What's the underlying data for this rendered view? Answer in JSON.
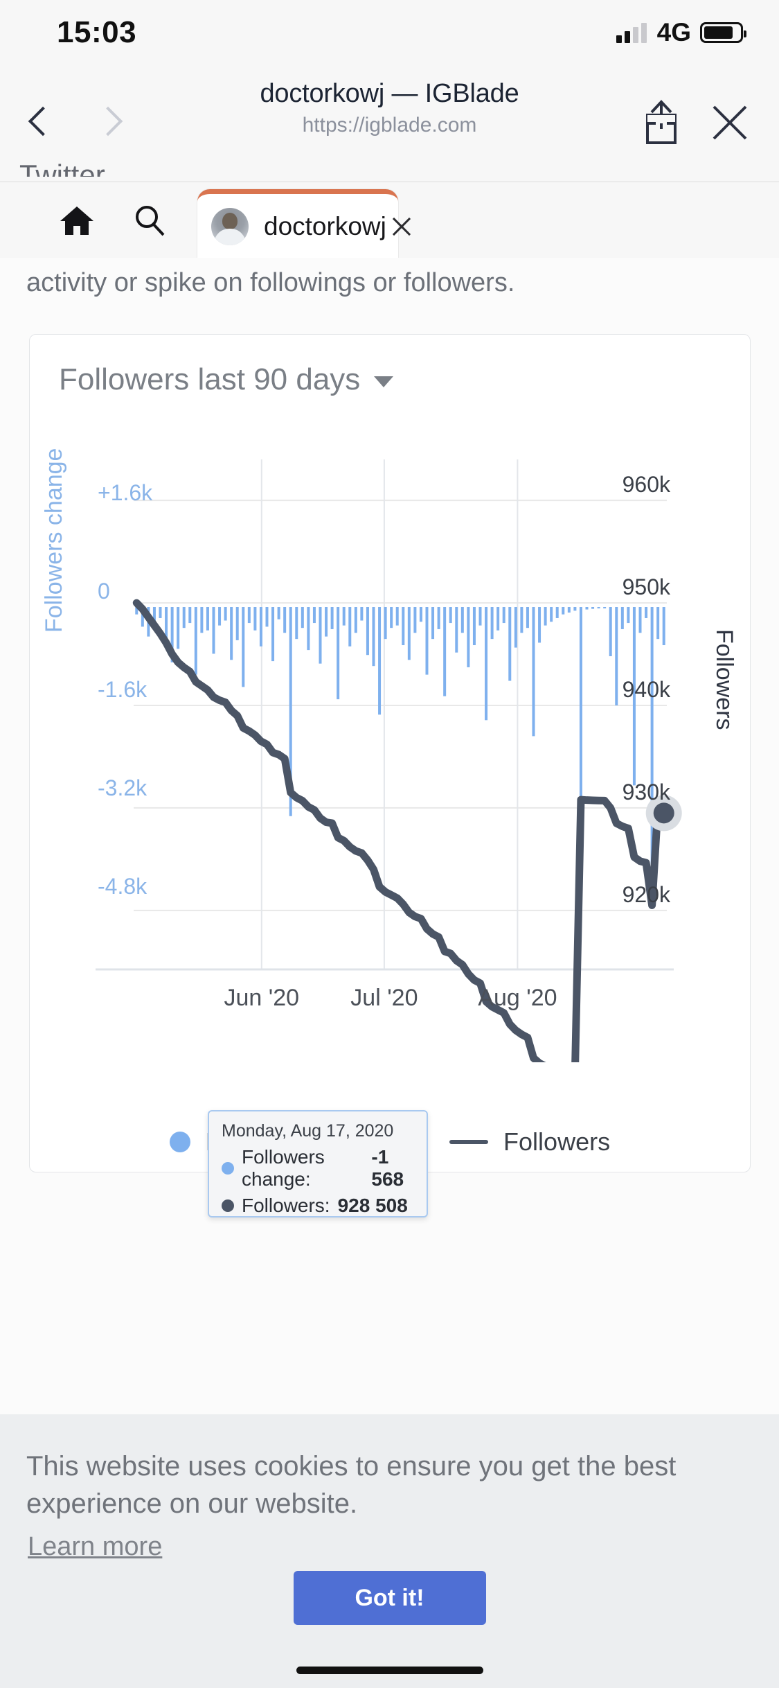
{
  "status_bar": {
    "time": "15:03",
    "network": "4G",
    "signal_icon": "cellular-signal-icon",
    "battery_icon": "battery-icon"
  },
  "browser": {
    "back_icon": "chevron-left-icon",
    "forward_icon": "chevron-right-icon",
    "title": "doctorkowj — IGBlade",
    "url": "https://igblade.com",
    "share_icon": "share-icon",
    "close_icon": "close-icon"
  },
  "tabstrip": {
    "ghost_text": "Twitter",
    "home_icon": "home-icon",
    "search_icon": "search-icon",
    "tab": {
      "avatar_icon": "avatar-icon",
      "label": "doctorkowj",
      "close_icon": "tab-close-icon",
      "accent_color": "#d9744f"
    }
  },
  "page": {
    "intro_text": "activity or spike on followings or followers.",
    "card": {
      "title": "Followers last 90 days",
      "dropdown_icon": "chevron-down-icon"
    }
  },
  "tooltip": {
    "date": "Monday, Aug 17, 2020",
    "rows": [
      {
        "marker": "blue",
        "label": "Followers change:",
        "value": "-1 568"
      },
      {
        "marker": "dark",
        "label": "Followers:",
        "value": "928 508"
      }
    ]
  },
  "cookie_banner": {
    "text": "This website uses cookies to ensure you get the best experience on our website.",
    "link": "Learn more",
    "button": "Got it!",
    "button_color": "#4f6fd4"
  },
  "chart_data": {
    "type": "line",
    "title": "Followers last 90 days",
    "xlabel": "",
    "ylabel": "Followers change",
    "y2label": "Followers",
    "grid": true,
    "legend_position": "bottom",
    "x_tick_labels": [
      "Jun '20",
      "Jul '20",
      "Aug '20"
    ],
    "x_tick_positions": [
      0.24,
      0.47,
      0.72
    ],
    "left_axis": {
      "label": "Followers change",
      "color": "#8ab4e8",
      "ticks": [
        "+1.6k",
        "0",
        "-1.6k",
        "-3.2k",
        "-4.8k"
      ],
      "tick_values": [
        1600,
        0,
        -1600,
        -3200,
        -4800
      ],
      "ylim": [
        -5600,
        2400
      ]
    },
    "right_axis": {
      "label": "Followers",
      "color": "#2f3542",
      "ticks": [
        "960k",
        "950k",
        "940k",
        "930k",
        "920k"
      ],
      "tick_values": [
        960000,
        950000,
        940000,
        930000,
        920000
      ],
      "ylim": [
        916000,
        964000
      ]
    },
    "series": [
      {
        "name": "Followers change",
        "type": "bar",
        "color": "#7eb0ee",
        "axis": "left",
        "values": [
          -120,
          -320,
          -480,
          -260,
          -180,
          -520,
          -900,
          -680,
          -340,
          -260,
          -1100,
          -420,
          -380,
          -760,
          -300,
          -220,
          -860,
          -540,
          -1300,
          -260,
          -380,
          -640,
          -320,
          -880,
          -200,
          -420,
          -3400,
          -520,
          -340,
          -700,
          -260,
          -920,
          -480,
          -360,
          -1500,
          -300,
          -640,
          -420,
          -220,
          -780,
          -960,
          -1750,
          -520,
          -340,
          -300,
          -620,
          -860,
          -420,
          -240,
          -1100,
          -520,
          -360,
          -1450,
          -260,
          -740,
          -420,
          -980,
          -620,
          -300,
          -1840,
          -520,
          -380,
          -260,
          -1200,
          -660,
          -420,
          -340,
          -2100,
          -580,
          -300,
          -240,
          -180,
          -120,
          -90,
          -60,
          -3400,
          -40,
          -30,
          -20,
          -15,
          -800,
          -1600,
          -360,
          -260,
          -2900,
          -420,
          -180,
          -4200,
          -520,
          -620
        ]
      },
      {
        "name": "Followers",
        "type": "line",
        "color": "#4b5566",
        "axis": "right",
        "values": [
          950000,
          949400,
          948600,
          947800,
          947000,
          946100,
          945000,
          944200,
          943700,
          943300,
          942300,
          941900,
          941500,
          940800,
          940500,
          940300,
          939500,
          939000,
          937800,
          937500,
          937100,
          936500,
          936200,
          935400,
          935200,
          934800,
          931500,
          931000,
          930700,
          930100,
          929800,
          929000,
          928600,
          928508,
          927100,
          926800,
          926200,
          925800,
          925600,
          924900,
          924000,
          922300,
          921800,
          921500,
          921200,
          920600,
          919800,
          919400,
          919200,
          918200,
          917700,
          917400,
          916000,
          915800,
          915100,
          914700,
          913800,
          913200,
          912900,
          911100,
          910600,
          910300,
          910000,
          908900,
          908300,
          907900,
          907600,
          905600,
          905100,
          904800,
          904600,
          904400,
          904300,
          904200,
          904150,
          930800,
          930760,
          930740,
          930720,
          930710,
          930000,
          928500,
          928200,
          928000,
          925200,
          924800,
          924650,
          920500,
          930100,
          929500
        ]
      }
    ],
    "highlight_point": {
      "label": "Monday, Aug 17, 2020",
      "followers": 928508,
      "followers_change": -1568
    },
    "legend": [
      {
        "label": "Followers change",
        "marker": "dot",
        "color": "#7eb0ee"
      },
      {
        "label": "Followers",
        "marker": "line",
        "color": "#4b5566"
      }
    ]
  }
}
